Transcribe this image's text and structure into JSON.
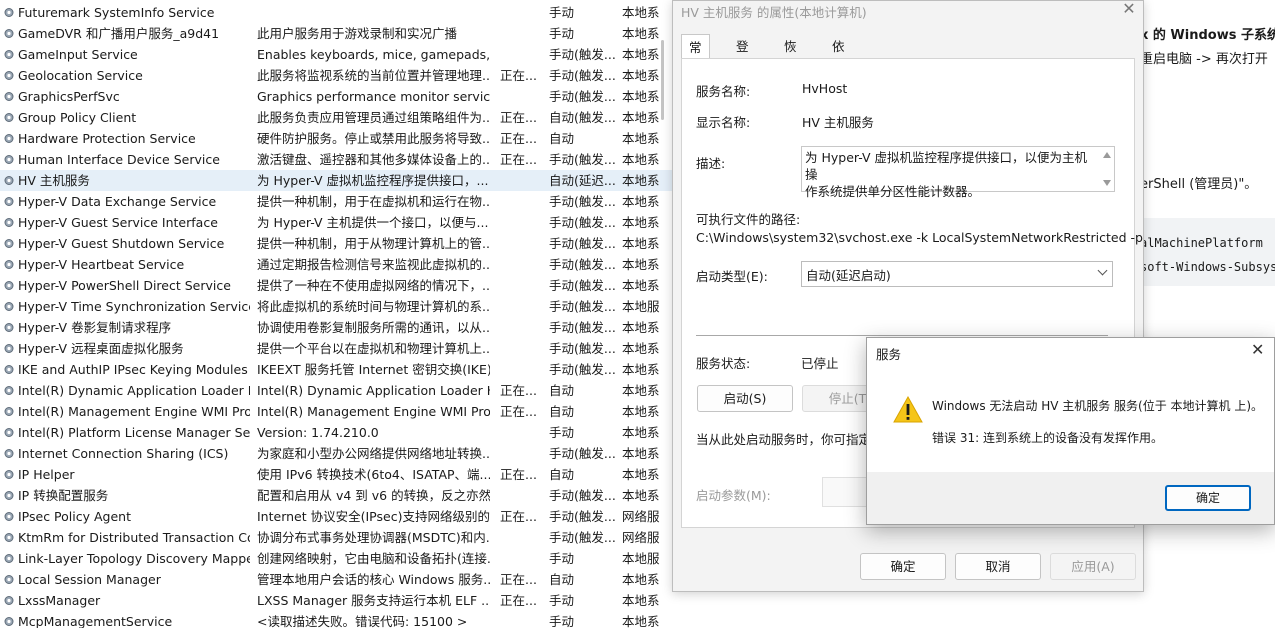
{
  "services": [
    {
      "name": "Futuremark SystemInfo Service",
      "desc": "",
      "status": "",
      "startup": "手动",
      "logon": "本地系"
    },
    {
      "name": "GameDVR 和广播用户服务_a9d41",
      "desc": "此用户服务用于游戏录制和实况广播",
      "status": "",
      "startup": "手动",
      "logon": "本地系"
    },
    {
      "name": "GameInput Service",
      "desc": "Enables keyboards, mice, gamepads, ...",
      "status": "",
      "startup": "手动(触发...",
      "logon": "本地系"
    },
    {
      "name": "Geolocation Service",
      "desc": "此服务将监视系统的当前位置并管理地理...",
      "status": "正在...",
      "startup": "手动(触发...",
      "logon": "本地系"
    },
    {
      "name": "GraphicsPerfSvc",
      "desc": "Graphics performance monitor service",
      "status": "",
      "startup": "手动(触发...",
      "logon": "本地系"
    },
    {
      "name": "Group Policy Client",
      "desc": "此服务负责应用管理员通过组策略组件为...",
      "status": "正在...",
      "startup": "自动(触发...",
      "logon": "本地系"
    },
    {
      "name": "Hardware Protection Service",
      "desc": "硬件防护服务。停止或禁用此服务将导致...",
      "status": "正在...",
      "startup": "自动",
      "logon": "本地系"
    },
    {
      "name": "Human Interface Device Service",
      "desc": "激活键盘、遥控器和其他多媒体设备上的...",
      "status": "正在...",
      "startup": "手动(触发...",
      "logon": "本地系"
    },
    {
      "name": "HV 主机服务",
      "desc": "为 Hyper-V 虚拟机监控程序提供接口，...",
      "status": "",
      "startup": "自动(延迟...",
      "logon": "本地系",
      "selected": true
    },
    {
      "name": "Hyper-V Data Exchange Service",
      "desc": "提供一种机制，用于在虚拟机和运行在物...",
      "status": "",
      "startup": "手动(触发...",
      "logon": "本地系"
    },
    {
      "name": "Hyper-V Guest Service Interface",
      "desc": "为 Hyper-V 主机提供一个接口，以便与...",
      "status": "",
      "startup": "手动(触发...",
      "logon": "本地系"
    },
    {
      "name": "Hyper-V Guest Shutdown Service",
      "desc": "提供一种机制，用于从物理计算机上的管...",
      "status": "",
      "startup": "手动(触发...",
      "logon": "本地系"
    },
    {
      "name": "Hyper-V Heartbeat Service",
      "desc": "通过定期报告检测信号来监视此虚拟机的...",
      "status": "",
      "startup": "手动(触发...",
      "logon": "本地系"
    },
    {
      "name": "Hyper-V PowerShell Direct Service",
      "desc": "提供了一种在不使用虚拟网络的情况下，...",
      "status": "",
      "startup": "手动(触发...",
      "logon": "本地系"
    },
    {
      "name": "Hyper-V Time Synchronization Service",
      "desc": "将此虚拟机的系统时间与物理计算机的系...",
      "status": "",
      "startup": "手动(触发...",
      "logon": "本地服"
    },
    {
      "name": "Hyper-V 卷影复制请求程序",
      "desc": "协调使用卷影复制服务所需的通讯，以从...",
      "status": "",
      "startup": "手动(触发...",
      "logon": "本地系"
    },
    {
      "name": "Hyper-V 远程桌面虚拟化服务",
      "desc": "提供一个平台以在虚拟机和物理计算机上...",
      "status": "",
      "startup": "手动(触发...",
      "logon": "本地系"
    },
    {
      "name": "IKE and AuthIP IPsec Keying Modules",
      "desc": "IKEEXT 服务托管 Internet 密钥交换(IKE)...",
      "status": "",
      "startup": "手动(触发...",
      "logon": "本地系"
    },
    {
      "name": "Intel(R) Dynamic Application Loader H...",
      "desc": "Intel(R) Dynamic Application Loader H...",
      "status": "正在...",
      "startup": "自动",
      "logon": "本地系"
    },
    {
      "name": "Intel(R) Management Engine WMI Pro...",
      "desc": "Intel(R) Management Engine WMI Pro...",
      "status": "正在...",
      "startup": "自动",
      "logon": "本地系"
    },
    {
      "name": "Intel(R) Platform License Manager Ser...",
      "desc": "Version: 1.74.210.0",
      "status": "",
      "startup": "手动",
      "logon": "本地系"
    },
    {
      "name": "Internet Connection Sharing (ICS)",
      "desc": "为家庭和小型办公网络提供网络地址转换...",
      "status": "",
      "startup": "手动(触发...",
      "logon": "本地系"
    },
    {
      "name": "IP Helper",
      "desc": "使用 IPv6 转换技术(6to4、ISATAP、端...",
      "status": "正在...",
      "startup": "自动",
      "logon": "本地系"
    },
    {
      "name": "IP 转换配置服务",
      "desc": "配置和启用从 v4 到 v6 的转换，反之亦然",
      "status": "",
      "startup": "手动(触发...",
      "logon": "本地系"
    },
    {
      "name": "IPsec Policy Agent",
      "desc": "Internet 协议安全(IPsec)支持网络级别的...",
      "status": "正在...",
      "startup": "手动(触发...",
      "logon": "网络服"
    },
    {
      "name": "KtmRm for Distributed Transaction Co...",
      "desc": "协调分布式事务处理协调器(MSDTC)和内...",
      "status": "",
      "startup": "手动(触发...",
      "logon": "网络服"
    },
    {
      "name": "Link-Layer Topology Discovery Mapper",
      "desc": "创建网络映射，它由电脑和设备拓扑(连接...",
      "status": "",
      "startup": "手动",
      "logon": "本地服"
    },
    {
      "name": "Local Session Manager",
      "desc": "管理本地用户会话的核心 Windows 服务...",
      "status": "正在...",
      "startup": "自动",
      "logon": "本地系"
    },
    {
      "name": "LxssManager",
      "desc": "LXSS Manager 服务支持运行本机 ELF ...",
      "status": "正在...",
      "startup": "手动",
      "logon": "本地系"
    },
    {
      "name": "McpManagementService",
      "desc": "<读取描述失败。错误代码: 15100 >",
      "status": "",
      "startup": "手动",
      "logon": "本地系"
    }
  ],
  "properties_dialog": {
    "title": "HV 主机服务 的属性(本地计算机)",
    "tabs": [
      "常规",
      "登录",
      "恢复",
      "依存关系"
    ],
    "labels": {
      "service_name": "服务名称:",
      "display_name": "显示名称:",
      "description": "描述:",
      "exe_path": "可执行文件的路径:",
      "startup_type": "启动类型(E):",
      "service_status": "服务状态:",
      "hint": "当从此处启动服务时，你可指定所",
      "start_params": "启动参数(M):"
    },
    "service_name": "HvHost",
    "display_name": "HV 主机服务",
    "description_line1": "为 Hyper-V 虚拟机监控程序提供接口，以便为主机操",
    "description_line2": "作系统提供单分区性能计数器。",
    "exe_path": "C:\\Windows\\system32\\svchost.exe -k LocalSystemNetworkRestricted -p",
    "startup_type": "自动(延迟启动)",
    "service_status": "已停止",
    "buttons": {
      "start": "启动(S)",
      "stop": "停止(T)",
      "ok": "确定",
      "cancel": "取消",
      "apply": "应用(A)"
    }
  },
  "error_popup": {
    "title": "服务",
    "message": "Windows 无法启动 HV 主机服务 服务(位于 本地计算机 上)。",
    "detail": "错误 31: 连到系统上的设备没有发挥作用。",
    "ok_label": "确定"
  },
  "background_doc": {
    "line1": "x 的 Windows 子系统",
    "line2": "重启电脑 -> 再次打开",
    "line3": "erShell (管理员)\"。",
    "code1": "alMachinePlatform",
    "code2": "soft-Windows-Subsys"
  },
  "colors": {
    "selection": "#e5eff8",
    "accent": "#0067c0",
    "warning": "#f5c518"
  }
}
